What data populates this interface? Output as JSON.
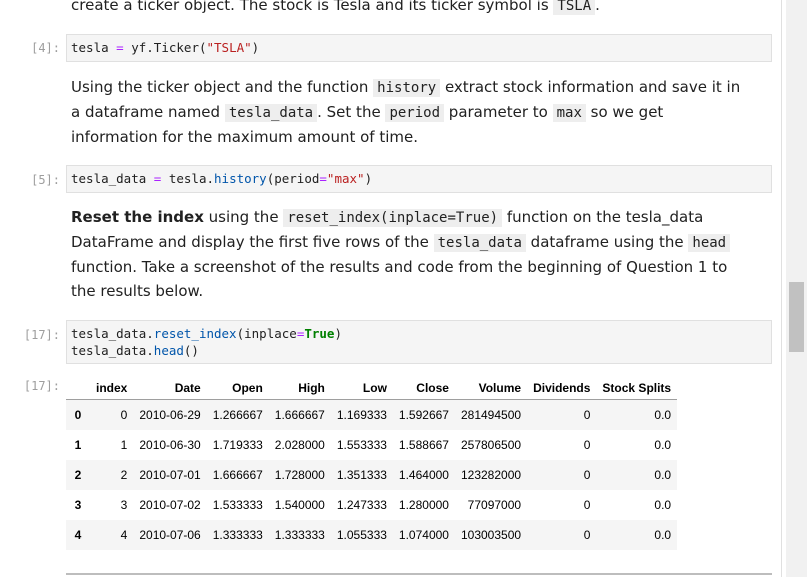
{
  "top_text": {
    "before": "create a ticker object. The stock is Tesla and its ticker symbol is ",
    "code": "TSLA",
    "after": "."
  },
  "cell4": {
    "prompt": "[4]:",
    "code": {
      "var": "tesla",
      "op": "=",
      "obj": "yf.Ticker",
      "open": "(",
      "str": "\"TSLA\"",
      "close": ")"
    }
  },
  "md1": {
    "t1": "Using the ticker object and the function ",
    "c1": "history",
    "t2": " extract stock information and save it in a dataframe named ",
    "c2": "tesla_data",
    "t3": ". Set the ",
    "c3": "period",
    "t4": " parameter to ",
    "c4": "max",
    "t5": " so we get information for the maximum amount of time."
  },
  "cell5": {
    "prompt": "[5]:",
    "code": {
      "var": "tesla_data",
      "op": "=",
      "obj": "tesla.",
      "fn": "history",
      "open": "(period",
      "op2": "=",
      "str": "\"max\"",
      "close": ")"
    }
  },
  "md2": {
    "bold": "Reset the index",
    "t1": " using the ",
    "c1": "reset_index(inplace=True)",
    "t2": " function on the tesla_data DataFrame and display the first five rows of the ",
    "c2": "tesla_data",
    "t3": " dataframe using the ",
    "c3": "head",
    "t4": " function. Take a screenshot of the results and code from the beginning of Question 1 to the results below."
  },
  "cell17": {
    "prompt": "[17]:",
    "line1": {
      "a": "tesla_data.",
      "fn": "reset_index",
      "b": "(inplace",
      "op": "=",
      "kw": "True",
      "c": ")"
    },
    "line2": {
      "a": "tesla_data.",
      "fn": "head",
      "b": "()"
    }
  },
  "output17": {
    "prompt": "[17]:",
    "columns": [
      "index",
      "Date",
      "Open",
      "High",
      "Low",
      "Close",
      "Volume",
      "Dividends",
      "Stock Splits"
    ],
    "rows": [
      {
        "idx": "0",
        "cells": [
          "0",
          "2010-06-29",
          "1.266667",
          "1.666667",
          "1.169333",
          "1.592667",
          "281494500",
          "0",
          "0.0"
        ]
      },
      {
        "idx": "1",
        "cells": [
          "1",
          "2010-06-30",
          "1.719333",
          "2.028000",
          "1.553333",
          "1.588667",
          "257806500",
          "0",
          "0.0"
        ]
      },
      {
        "idx": "2",
        "cells": [
          "2",
          "2010-07-01",
          "1.666667",
          "1.728000",
          "1.351333",
          "1.464000",
          "123282000",
          "0",
          "0.0"
        ]
      },
      {
        "idx": "3",
        "cells": [
          "3",
          "2010-07-02",
          "1.533333",
          "1.540000",
          "1.247333",
          "1.280000",
          "77097000",
          "0",
          "0.0"
        ]
      },
      {
        "idx": "4",
        "cells": [
          "4",
          "2010-07-06",
          "1.333333",
          "1.333333",
          "1.055333",
          "1.074000",
          "103003500",
          "0",
          "0.0"
        ]
      }
    ]
  }
}
